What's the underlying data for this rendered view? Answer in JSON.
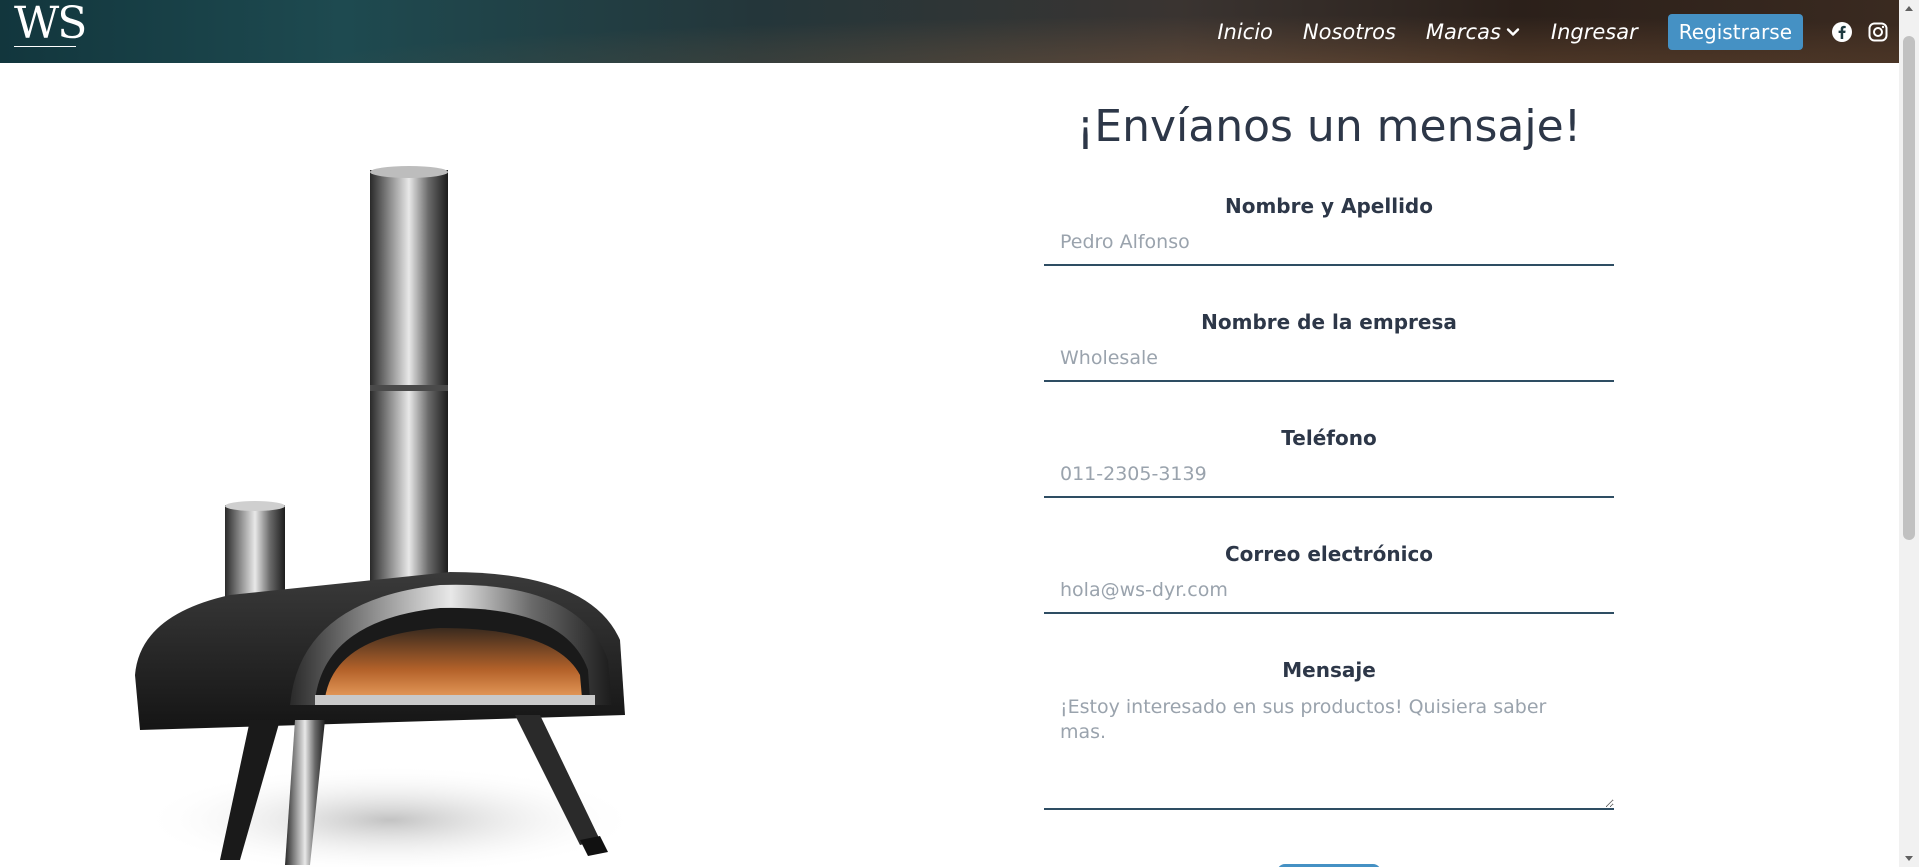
{
  "header": {
    "logo": "WS",
    "nav": [
      {
        "label": "Inicio"
      },
      {
        "label": "Nosotros"
      },
      {
        "label": "Marcas"
      },
      {
        "label": "Ingresar"
      }
    ],
    "register_label": "Registrarse",
    "social": [
      "facebook-icon",
      "instagram-icon"
    ]
  },
  "form": {
    "title": "¡Envíanos un mensaje!",
    "fields": [
      {
        "label": "Nombre y Apellido",
        "placeholder": "Pedro Alfonso"
      },
      {
        "label": "Nombre de la empresa",
        "placeholder": "Wholesale"
      },
      {
        "label": "Teléfono",
        "placeholder": "011-2305-3139"
      },
      {
        "label": "Correo electrónico",
        "placeholder": "hola@ws-dyr.com"
      }
    ],
    "message": {
      "label": "Mensaje",
      "placeholder": "¡Estoy interesado en sus productos! Quisiera saber mas."
    }
  },
  "colors": {
    "accent": "#4591c4",
    "input_border": "#2e4d63",
    "text": "#2d3748",
    "placeholder": "#9aa3ad"
  }
}
